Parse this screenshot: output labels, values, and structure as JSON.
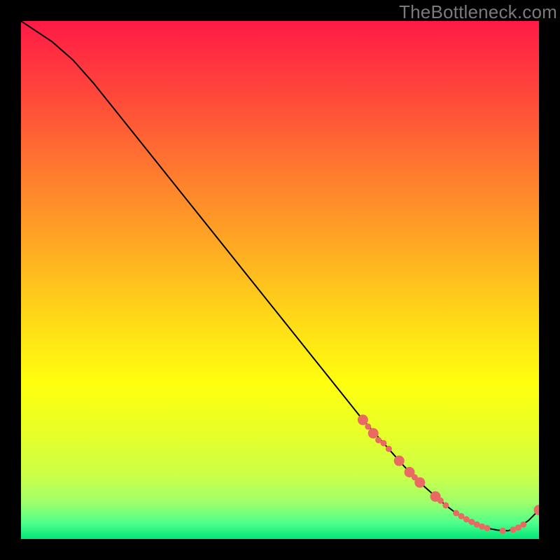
{
  "watermark": "TheBottleneck.com",
  "chart_data": {
    "type": "line",
    "title": "",
    "xlabel": "",
    "ylabel": "",
    "xlim": [
      0,
      100
    ],
    "ylim": [
      0,
      100
    ],
    "grid": false,
    "legend": false,
    "series": [
      {
        "name": "bottleneck-curve",
        "color": "#000000",
        "x": [
          0,
          3,
          6,
          10,
          14,
          18,
          22,
          26,
          30,
          34,
          38,
          42,
          46,
          50,
          54,
          58,
          62,
          66,
          70,
          74,
          78,
          82,
          84,
          86,
          88,
          90,
          92,
          94,
          96,
          98,
          100
        ],
        "y": [
          100,
          98,
          96,
          92.5,
          88,
          83,
          78,
          73,
          68,
          63,
          58,
          53,
          48,
          43,
          38,
          33,
          28,
          23,
          18.5,
          14,
          10,
          6.5,
          5,
          3.8,
          2.8,
          2.1,
          1.7,
          1.6,
          2.2,
          3.6,
          5.6
        ]
      }
    ],
    "markers": {
      "name": "highlighted-points",
      "color": "#e86a63",
      "radius_small": 4.5,
      "radius_large": 7.5,
      "points": [
        {
          "x": 66,
          "y": 23,
          "r": "large"
        },
        {
          "x": 67,
          "y": 21.7,
          "r": "small"
        },
        {
          "x": 68,
          "y": 20.4,
          "r": "large"
        },
        {
          "x": 69,
          "y": 19.1,
          "r": "small"
        },
        {
          "x": 70,
          "y": 18.5,
          "r": "small"
        },
        {
          "x": 71,
          "y": 17.4,
          "r": "small"
        },
        {
          "x": 73,
          "y": 15.1,
          "r": "large"
        },
        {
          "x": 75,
          "y": 12.9,
          "r": "large"
        },
        {
          "x": 76,
          "y": 11.9,
          "r": "small"
        },
        {
          "x": 77,
          "y": 10.9,
          "r": "large"
        },
        {
          "x": 80,
          "y": 8.2,
          "r": "large"
        },
        {
          "x": 81,
          "y": 7.4,
          "r": "small"
        },
        {
          "x": 82,
          "y": 6.5,
          "r": "small"
        },
        {
          "x": 84,
          "y": 5.0,
          "r": "small"
        },
        {
          "x": 85,
          "y": 4.4,
          "r": "small"
        },
        {
          "x": 86,
          "y": 3.8,
          "r": "small"
        },
        {
          "x": 87,
          "y": 3.3,
          "r": "small"
        },
        {
          "x": 88,
          "y": 2.8,
          "r": "small"
        },
        {
          "x": 89,
          "y": 2.4,
          "r": "small"
        },
        {
          "x": 90,
          "y": 2.1,
          "r": "small"
        },
        {
          "x": 93,
          "y": 1.6,
          "r": "small"
        },
        {
          "x": 95,
          "y": 1.8,
          "r": "small"
        },
        {
          "x": 96,
          "y": 2.2,
          "r": "small"
        },
        {
          "x": 97,
          "y": 2.8,
          "r": "small"
        },
        {
          "x": 100,
          "y": 5.6,
          "r": "large"
        }
      ]
    }
  }
}
